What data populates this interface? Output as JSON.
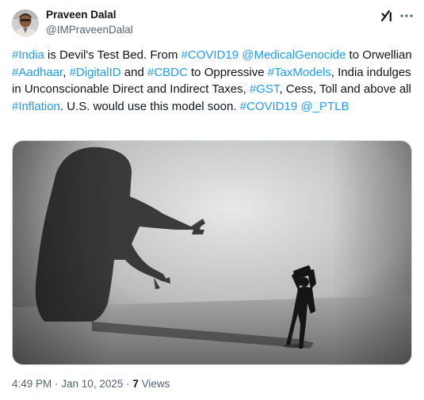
{
  "author": {
    "name": "Praveen Dalal",
    "handle": "@IMPraveenDalal"
  },
  "tweet": {
    "segments": [
      {
        "text": "#India",
        "highlight": true
      },
      {
        "text": " is Devil's Test Bed. From ",
        "highlight": false
      },
      {
        "text": "#COVID19",
        "highlight": true
      },
      {
        "text": " ",
        "highlight": false
      },
      {
        "text": "@MedicalGenocide",
        "highlight": true
      },
      {
        "text": " to Orwellian ",
        "highlight": false
      },
      {
        "text": "#Aadhaar",
        "highlight": true
      },
      {
        "text": ", ",
        "highlight": false
      },
      {
        "text": "#DigitalID",
        "highlight": true
      },
      {
        "text": " and ",
        "highlight": false
      },
      {
        "text": "#CBDC",
        "highlight": true
      },
      {
        "text": " to Oppressive ",
        "highlight": false
      },
      {
        "text": "#TaxModels",
        "highlight": true
      },
      {
        "text": ", India indulges in Unconscionable Direct and Indirect Taxes, ",
        "highlight": false
      },
      {
        "text": "#GST",
        "highlight": true
      },
      {
        "text": ", Cess, Toll and above all ",
        "highlight": false
      },
      {
        "text": "#Inflation",
        "highlight": true
      },
      {
        "text": ". U.S. would use this model soon. ",
        "highlight": false
      },
      {
        "text": "#COVID19",
        "highlight": true
      },
      {
        "text": " ",
        "highlight": false
      },
      {
        "text": "@_PTLB",
        "highlight": true
      }
    ]
  },
  "meta": {
    "time": "4:49 PM",
    "separator1": " · ",
    "date": "Jan 10, 2025",
    "separator2": " · ",
    "views_count": "7",
    "views_label": " Views"
  },
  "icons": {
    "grok": "grok-icon",
    "more": "more-horizontal-icon"
  },
  "colors": {
    "link": "#1d9bf0",
    "text": "#0f1419",
    "secondary": "#536471"
  }
}
